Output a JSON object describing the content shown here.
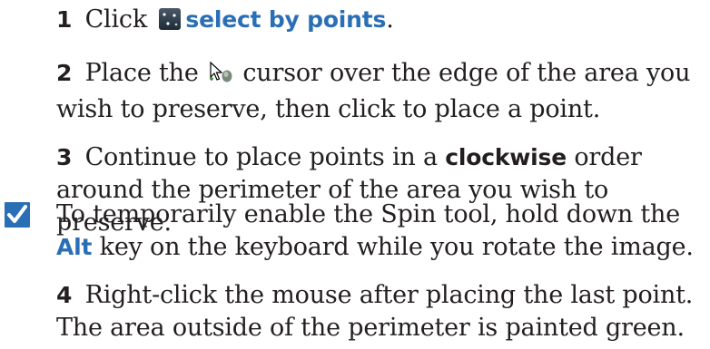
{
  "step1": {
    "number": "1",
    "text_before": "Click",
    "action_label": "select by points",
    "text_after": ".",
    "icon": "select-by-points-icon"
  },
  "step2": {
    "number": "2",
    "text_before": "Place the",
    "text_after": "cursor over the edge of the area you wish to preserve, then click to place a point.",
    "icon": "points-cursor-icon"
  },
  "step3": {
    "number": "3",
    "text_before": "Continue to place points in a",
    "emphasis": "clockwise",
    "text_after": "order around the perimeter of the area you wish to preserve."
  },
  "tip": {
    "icon": "checkmark-icon",
    "text_before": "To temporarily enable the Spin tool, hold down the",
    "key": "Alt",
    "text_after": "key on the keyboard while you rotate the image.",
    "accent_color": "#2a6fb5"
  },
  "step4": {
    "number": "4",
    "text": "Right-click the mouse after placing the last point. The area outside of the perimeter is painted green."
  }
}
